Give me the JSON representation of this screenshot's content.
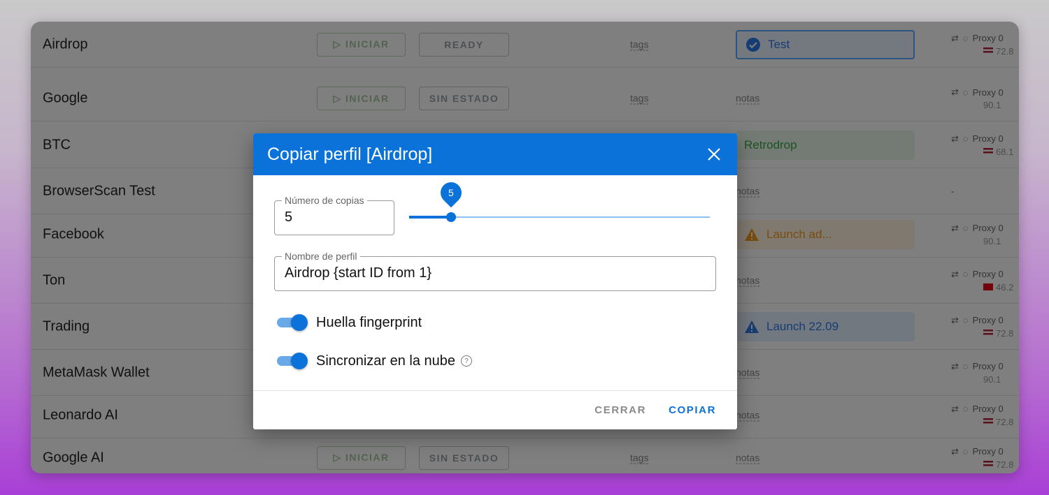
{
  "rows": [
    {
      "name": "Airdrop",
      "iniciar": "▷ INICIAR",
      "status": "READY",
      "tags": "tags",
      "note": "Test",
      "proxy": "Proxy 0",
      "proxy_ip": "72.8"
    },
    {
      "name": "Google",
      "iniciar": "▷ INICIAR",
      "status": "SIN ESTADO",
      "tags": "tags",
      "note": "notas",
      "proxy": "Proxy 0",
      "proxy_ip": "90.1"
    },
    {
      "name": "BTC",
      "note": "Retrodrop",
      "proxy": "Proxy 0",
      "proxy_ip": "68.1"
    },
    {
      "name": "BrowserScan Test",
      "note": "notas",
      "proxy": "-"
    },
    {
      "name": "Facebook",
      "note": "Launch ad...",
      "proxy": "Proxy 0",
      "proxy_ip": "90.1"
    },
    {
      "name": "Ton",
      "note": "notas",
      "proxy": "Proxy 0",
      "proxy_ip": "46.2"
    },
    {
      "name": "Trading",
      "note": "Launch 22.09",
      "proxy": "Proxy 0",
      "proxy_ip": "72.8"
    },
    {
      "name": "MetaMask Wallet",
      "note": "notas",
      "proxy": "Proxy 0",
      "proxy_ip": "90.1"
    },
    {
      "name": "Leonardo AI",
      "note": "notas",
      "proxy": "Proxy 0",
      "proxy_ip": "72.8"
    },
    {
      "name": "Google AI",
      "iniciar": "▷ INICIAR",
      "status": "SIN ESTADO",
      "tags": "tags",
      "note": "notas",
      "proxy": "Proxy 0",
      "proxy_ip": "72.8"
    }
  ],
  "dialog": {
    "title": "Copiar perfil [Airdrop]",
    "copies_label": "Número de copias",
    "copies_value": "5",
    "slider_value": "5",
    "slider_fraction": 0.14,
    "name_label": "Nombre de perfil",
    "name_value": "Airdrop {start ID from 1}",
    "fingerprint_label": "Huella fingerprint",
    "cloud_label": "Sincronizar en la nube",
    "close_label": "CERRAR",
    "copy_label": "COPIAR"
  },
  "colors": {
    "accent": "#0a72d8",
    "overlay": "rgba(0,0,0,0.5)"
  }
}
